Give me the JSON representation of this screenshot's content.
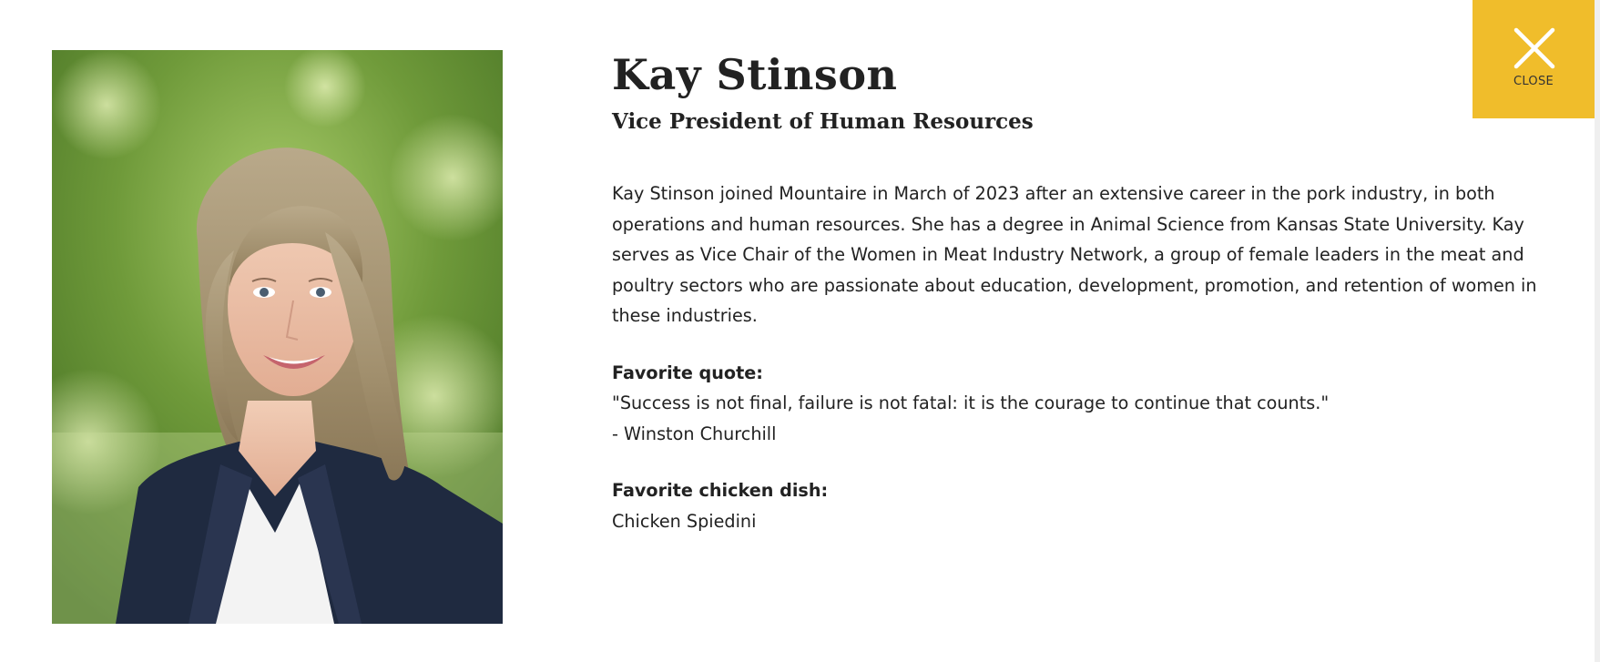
{
  "profile": {
    "name": "Kay Stinson",
    "title": "Vice President of Human Resources",
    "bio": "Kay Stinson joined Mountaire in March of 2023 after an extensive career in the pork industry, in both operations and human resources. She has a degree in Animal Science from Kansas State University. Kay serves as Vice Chair of the Women in Meat Industry Network, a group of female leaders in the meat and poultry sectors who are passionate about education, development, promotion, and retention of women in these industries.",
    "favorite_quote": {
      "label": "Favorite quote:",
      "quote": "\"Success is not final, failure is not fatal: it is the courage to continue that counts.\"",
      "attribution": "- Winston Churchill"
    },
    "favorite_dish": {
      "label": "Favorite chicken dish:",
      "value": "Chicken Spiedini"
    }
  },
  "close_button": {
    "label": "CLOSE",
    "icon": "close-icon"
  },
  "colors": {
    "accent": "#f0bd2b",
    "text": "#222222"
  }
}
